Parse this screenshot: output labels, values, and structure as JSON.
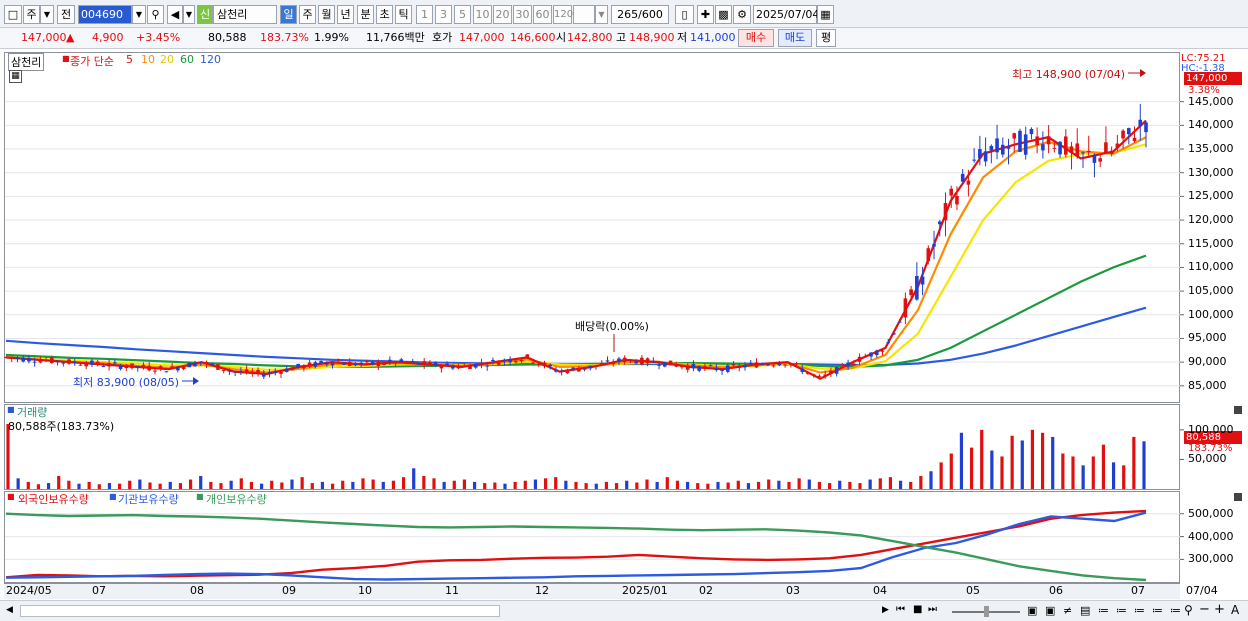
{
  "toolbar": {
    "market": "주",
    "prev": "전",
    "code": "004690",
    "badge": "신",
    "name": "삼천리",
    "periods": [
      "일",
      "주",
      "월",
      "년",
      "분",
      "초",
      "틱"
    ],
    "intervals": [
      "1",
      "3",
      "5",
      "10",
      "20",
      "30",
      "60",
      "120"
    ],
    "count": "265",
    "count_total": "/600",
    "date": "2025/07/04"
  },
  "quote": {
    "price": "147,000",
    "change_icon": "▲",
    "change": "4,900",
    "change_pct": "+3.45%",
    "volume": "80,588",
    "volume_ratio": "183.73%",
    "turnover_pct": "1.99%",
    "amount": "11,766백만",
    "ask_label": "호가",
    "ask": "147,000",
    "bid": "146,600",
    "open_label": "시",
    "open": "142,800",
    "high_label": "고",
    "high": "148,900",
    "low_label": "저",
    "low": "141,000",
    "buy": "매수",
    "sell": "매도",
    "eval": "평"
  },
  "price_panel": {
    "stock_tag": "삼천리",
    "legend_prefix": "종가 단순",
    "ma_labels": [
      "5",
      "10",
      "20",
      "60",
      "120"
    ],
    "lc": "LC:75.21",
    "hc": "HC:-1.38",
    "current_price": "147,000",
    "current_pct": "3.38%",
    "high_annotation": "최고 148,900 (07/04)",
    "low_annotation": "최저 83,900 (08/05)",
    "event_annotation": "배당락(0.00%)",
    "yticks": [
      "145,000",
      "140,000",
      "135,000",
      "130,000",
      "125,000",
      "120,000",
      "115,000",
      "110,000",
      "105,000",
      "100,000",
      "95,000",
      "90,000",
      "85,000"
    ]
  },
  "volume_panel": {
    "title": "거래량",
    "last_label": "80,588주(183.73%)",
    "current": "80,588",
    "current_pct": "183.73%",
    "yticks": [
      "100,000",
      "50,000"
    ]
  },
  "holding_panel": {
    "legend": [
      "외국인보유수량",
      "기관보유수량",
      "개인보유수량"
    ],
    "yticks": [
      "500,000",
      "400,000",
      "300,000"
    ]
  },
  "x_axis": {
    "labels": [
      "2024/05",
      "07",
      "08",
      "09",
      "10",
      "11",
      "12",
      "2025/01",
      "02",
      "03",
      "04",
      "05",
      "06",
      "07"
    ],
    "right_label": "07/04"
  },
  "colors": {
    "up": "#e01010",
    "down": "#1f3fd0",
    "ma5": "#e01010",
    "ma10": "#ff8c00",
    "ma20": "#f5e600",
    "ma60": "#1a9a3a",
    "ma120": "#2d5be0",
    "foreign": "#e01010",
    "institution": "#2d5be0",
    "individual": "#3a9a5a"
  },
  "chart_data": [
    {
      "type": "candlestick",
      "title": "삼천리",
      "x_range": [
        "2024/05",
        "2025/07/04"
      ],
      "ylim": [
        82000,
        150000
      ],
      "series": [
        {
          "name": "5",
          "values": [
            91000,
            90500,
            90000,
            89500,
            89000,
            88500,
            90000,
            88000,
            87500,
            89000,
            90000,
            89500,
            90000,
            89500,
            89000,
            90000,
            91000,
            88000,
            89000,
            90500,
            90000,
            89000,
            88500,
            89500,
            90000,
            86500,
            90000,
            93000,
            106000,
            124000,
            134000,
            136000,
            137500,
            133000,
            134500,
            141000
          ]
        },
        {
          "name": "10",
          "values": [
            91000,
            90500,
            90000,
            89800,
            89200,
            88800,
            89500,
            88500,
            87800,
            88600,
            89600,
            89600,
            89800,
            89600,
            89200,
            89800,
            90600,
            89000,
            89100,
            90000,
            90100,
            89300,
            88900,
            89300,
            89800,
            87800,
            88800,
            91500,
            101000,
            117000,
            129000,
            134500,
            136500,
            134500,
            134000,
            137500
          ]
        },
        {
          "name": "20",
          "values": [
            91000,
            90700,
            90300,
            90000,
            89700,
            89300,
            89300,
            89000,
            88400,
            88500,
            89000,
            89200,
            89500,
            89600,
            89400,
            89600,
            90100,
            89500,
            89300,
            89700,
            89900,
            89500,
            89200,
            89200,
            89600,
            88600,
            88700,
            90200,
            96000,
            108000,
            120000,
            128000,
            132500,
            134000,
            134200,
            136000
          ]
        },
        {
          "name": "60",
          "values": [
            91500,
            91200,
            90900,
            90700,
            90400,
            90100,
            89800,
            89600,
            89300,
            89100,
            89000,
            89000,
            89100,
            89200,
            89300,
            89400,
            89500,
            89500,
            89600,
            89700,
            89800,
            89800,
            89700,
            89600,
            89500,
            89200,
            89000,
            89300,
            90500,
            93000,
            96500,
            100000,
            103500,
            107000,
            110000,
            112500
          ]
        },
        {
          "name": "120",
          "values": [
            94500,
            94000,
            93600,
            93200,
            92700,
            92300,
            91900,
            91500,
            91100,
            90800,
            90500,
            90300,
            90100,
            89900,
            89800,
            89700,
            89700,
            89600,
            89600,
            89600,
            89600,
            89600,
            89600,
            89600,
            89600,
            89500,
            89400,
            89400,
            89700,
            90500,
            91800,
            93500,
            95500,
            97500,
            99500,
            101500
          ]
        }
      ],
      "annotations": [
        "최고 148,900 (07/04)",
        "최저 83,900 (08/05)",
        "배당락(0.00%)"
      ]
    },
    {
      "type": "bar",
      "title": "거래량",
      "ylim": [
        0,
        120000
      ],
      "last_value": 80588,
      "values": [
        110000,
        18000,
        12000,
        8000,
        10000,
        22000,
        14000,
        9000,
        12000,
        8000,
        10000,
        9000,
        14000,
        16000,
        11000,
        9000,
        12000,
        10000,
        16000,
        22000,
        12000,
        10000,
        14000,
        18000,
        12000,
        9000,
        14000,
        11000,
        16000,
        20000,
        10000,
        12000,
        9000,
        14000,
        12000,
        18000,
        16000,
        12000,
        14000,
        20000,
        35000,
        22000,
        18000,
        12000,
        14000,
        16000,
        12000,
        10000,
        11000,
        9000,
        12000,
        14000,
        16000,
        18000,
        20000,
        14000,
        12000,
        10000,
        9000,
        12000,
        10000,
        14000,
        11000,
        16000,
        12000,
        20000,
        14000,
        12000,
        10000,
        9000,
        12000,
        11000,
        14000,
        10000,
        12000,
        16000,
        14000,
        12000,
        18000,
        16000,
        12000,
        10000,
        14000,
        12000,
        10000,
        16000,
        18000,
        20000,
        14000,
        12000,
        22000,
        30000,
        45000,
        60000,
        95000,
        70000,
        100000,
        65000,
        55000,
        90000,
        82000,
        100000,
        95000,
        88000,
        60000,
        55000,
        40000,
        55000,
        75000,
        45000,
        40000,
        88000,
        80588
      ]
    },
    {
      "type": "line",
      "title": "외국인보유수량 / 기관보유수량 / 개인보유수량",
      "ylim": [
        210000,
        560000
      ],
      "series": [
        {
          "name": "외국인보유수량",
          "values": [
            222000,
            232000,
            230000,
            226000,
            228000,
            226000,
            229000,
            231000,
            233000,
            240000,
            255000,
            262000,
            272000,
            290000,
            296000,
            298000,
            303000,
            307000,
            308000,
            312000,
            320000,
            312000,
            305000,
            300000,
            298000,
            300000,
            305000,
            320000,
            345000,
            370000,
            395000,
            420000,
            445000,
            478000,
            495000,
            505000,
            512000
          ]
        },
        {
          "name": "기관보유수량",
          "values": [
            220000,
            222000,
            224000,
            226000,
            228000,
            232000,
            236000,
            238000,
            236000,
            230000,
            222000,
            214000,
            212000,
            214000,
            216000,
            218000,
            220000,
            222000,
            226000,
            228000,
            230000,
            232000,
            234000,
            236000,
            240000,
            244000,
            250000,
            262000,
            310000,
            350000,
            372000,
            410000,
            455000,
            488000,
            478000,
            468000,
            505000
          ]
        },
        {
          "name": "개인보유수량",
          "values": [
            500000,
            494000,
            490000,
            492000,
            494000,
            490000,
            488000,
            484000,
            478000,
            470000,
            462000,
            455000,
            448000,
            442000,
            440000,
            442000,
            444000,
            442000,
            440000,
            438000,
            435000,
            430000,
            428000,
            430000,
            432000,
            426000,
            418000,
            405000,
            380000,
            355000,
            330000,
            300000,
            270000,
            250000,
            230000,
            218000,
            210000
          ]
        }
      ]
    }
  ]
}
